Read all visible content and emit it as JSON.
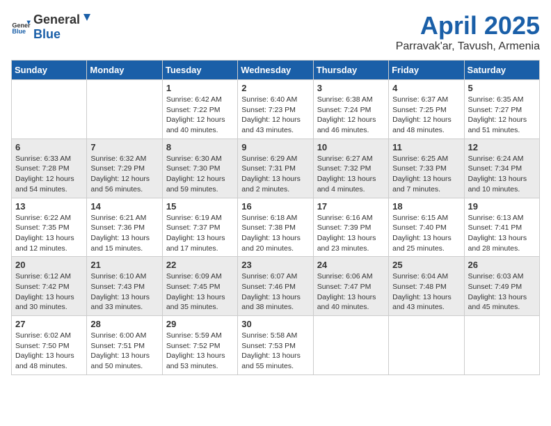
{
  "header": {
    "logo_general": "General",
    "logo_blue": "Blue",
    "month": "April 2025",
    "location": "Parravak'ar, Tavush, Armenia"
  },
  "weekdays": [
    "Sunday",
    "Monday",
    "Tuesday",
    "Wednesday",
    "Thursday",
    "Friday",
    "Saturday"
  ],
  "rows": [
    [
      {
        "day": "",
        "sunrise": "",
        "sunset": "",
        "daylight": ""
      },
      {
        "day": "",
        "sunrise": "",
        "sunset": "",
        "daylight": ""
      },
      {
        "day": "1",
        "sunrise": "6:42 AM",
        "sunset": "7:22 PM",
        "daylight": "12 hours and 40 minutes."
      },
      {
        "day": "2",
        "sunrise": "6:40 AM",
        "sunset": "7:23 PM",
        "daylight": "12 hours and 43 minutes."
      },
      {
        "day": "3",
        "sunrise": "6:38 AM",
        "sunset": "7:24 PM",
        "daylight": "12 hours and 46 minutes."
      },
      {
        "day": "4",
        "sunrise": "6:37 AM",
        "sunset": "7:25 PM",
        "daylight": "12 hours and 48 minutes."
      },
      {
        "day": "5",
        "sunrise": "6:35 AM",
        "sunset": "7:27 PM",
        "daylight": "12 hours and 51 minutes."
      }
    ],
    [
      {
        "day": "6",
        "sunrise": "6:33 AM",
        "sunset": "7:28 PM",
        "daylight": "12 hours and 54 minutes."
      },
      {
        "day": "7",
        "sunrise": "6:32 AM",
        "sunset": "7:29 PM",
        "daylight": "12 hours and 56 minutes."
      },
      {
        "day": "8",
        "sunrise": "6:30 AM",
        "sunset": "7:30 PM",
        "daylight": "12 hours and 59 minutes."
      },
      {
        "day": "9",
        "sunrise": "6:29 AM",
        "sunset": "7:31 PM",
        "daylight": "13 hours and 2 minutes."
      },
      {
        "day": "10",
        "sunrise": "6:27 AM",
        "sunset": "7:32 PM",
        "daylight": "13 hours and 4 minutes."
      },
      {
        "day": "11",
        "sunrise": "6:25 AM",
        "sunset": "7:33 PM",
        "daylight": "13 hours and 7 minutes."
      },
      {
        "day": "12",
        "sunrise": "6:24 AM",
        "sunset": "7:34 PM",
        "daylight": "13 hours and 10 minutes."
      }
    ],
    [
      {
        "day": "13",
        "sunrise": "6:22 AM",
        "sunset": "7:35 PM",
        "daylight": "13 hours and 12 minutes."
      },
      {
        "day": "14",
        "sunrise": "6:21 AM",
        "sunset": "7:36 PM",
        "daylight": "13 hours and 15 minutes."
      },
      {
        "day": "15",
        "sunrise": "6:19 AM",
        "sunset": "7:37 PM",
        "daylight": "13 hours and 17 minutes."
      },
      {
        "day": "16",
        "sunrise": "6:18 AM",
        "sunset": "7:38 PM",
        "daylight": "13 hours and 20 minutes."
      },
      {
        "day": "17",
        "sunrise": "6:16 AM",
        "sunset": "7:39 PM",
        "daylight": "13 hours and 23 minutes."
      },
      {
        "day": "18",
        "sunrise": "6:15 AM",
        "sunset": "7:40 PM",
        "daylight": "13 hours and 25 minutes."
      },
      {
        "day": "19",
        "sunrise": "6:13 AM",
        "sunset": "7:41 PM",
        "daylight": "13 hours and 28 minutes."
      }
    ],
    [
      {
        "day": "20",
        "sunrise": "6:12 AM",
        "sunset": "7:42 PM",
        "daylight": "13 hours and 30 minutes."
      },
      {
        "day": "21",
        "sunrise": "6:10 AM",
        "sunset": "7:43 PM",
        "daylight": "13 hours and 33 minutes."
      },
      {
        "day": "22",
        "sunrise": "6:09 AM",
        "sunset": "7:45 PM",
        "daylight": "13 hours and 35 minutes."
      },
      {
        "day": "23",
        "sunrise": "6:07 AM",
        "sunset": "7:46 PM",
        "daylight": "13 hours and 38 minutes."
      },
      {
        "day": "24",
        "sunrise": "6:06 AM",
        "sunset": "7:47 PM",
        "daylight": "13 hours and 40 minutes."
      },
      {
        "day": "25",
        "sunrise": "6:04 AM",
        "sunset": "7:48 PM",
        "daylight": "13 hours and 43 minutes."
      },
      {
        "day": "26",
        "sunrise": "6:03 AM",
        "sunset": "7:49 PM",
        "daylight": "13 hours and 45 minutes."
      }
    ],
    [
      {
        "day": "27",
        "sunrise": "6:02 AM",
        "sunset": "7:50 PM",
        "daylight": "13 hours and 48 minutes."
      },
      {
        "day": "28",
        "sunrise": "6:00 AM",
        "sunset": "7:51 PM",
        "daylight": "13 hours and 50 minutes."
      },
      {
        "day": "29",
        "sunrise": "5:59 AM",
        "sunset": "7:52 PM",
        "daylight": "13 hours and 53 minutes."
      },
      {
        "day": "30",
        "sunrise": "5:58 AM",
        "sunset": "7:53 PM",
        "daylight": "13 hours and 55 minutes."
      },
      {
        "day": "",
        "sunrise": "",
        "sunset": "",
        "daylight": ""
      },
      {
        "day": "",
        "sunrise": "",
        "sunset": "",
        "daylight": ""
      },
      {
        "day": "",
        "sunrise": "",
        "sunset": "",
        "daylight": ""
      }
    ]
  ],
  "labels": {
    "sunrise_prefix": "Sunrise: ",
    "sunset_prefix": "Sunset: ",
    "daylight_prefix": "Daylight: "
  }
}
